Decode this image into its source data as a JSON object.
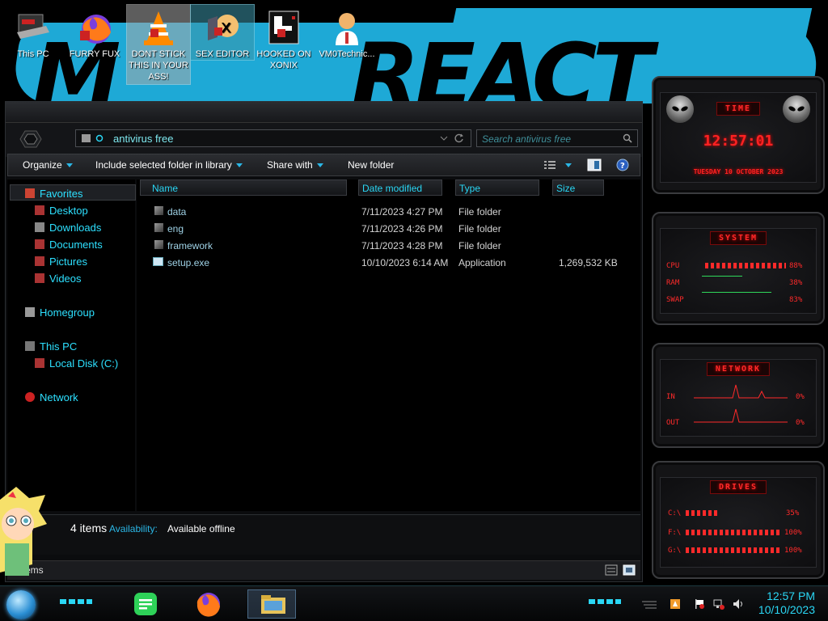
{
  "desktop": {
    "icons": [
      {
        "label": "This PC"
      },
      {
        "label": "FURRY FUX"
      },
      {
        "label": "DONT STICK THIS IN YOUR ASS!"
      },
      {
        "label": "SEX EDITOR"
      },
      {
        "label": "HOOKED ON XONIX"
      },
      {
        "label": "VM0Technic..."
      }
    ]
  },
  "explorer": {
    "address": "antivirus free",
    "search_placeholder": "Search antivirus free",
    "toolbar": {
      "organize": "Organize",
      "include": "Include selected folder in library",
      "share": "Share with",
      "new_folder": "New folder"
    },
    "nav": {
      "favorites": "Favorites",
      "desktop": "Desktop",
      "downloads": "Downloads",
      "documents": "Documents",
      "pictures": "Pictures",
      "videos": "Videos",
      "homegroup": "Homegroup",
      "this_pc": "This PC",
      "local_disk": "Local Disk (C:)",
      "network": "Network"
    },
    "columns": {
      "name": "Name",
      "date": "Date modified",
      "type": "Type",
      "size": "Size"
    },
    "files": [
      {
        "name": "data",
        "date": "7/11/2023 4:27 PM",
        "type": "File folder",
        "size": ""
      },
      {
        "name": "eng",
        "date": "7/11/2023 4:26 PM",
        "type": "File folder",
        "size": ""
      },
      {
        "name": "framework",
        "date": "7/11/2023 4:28 PM",
        "type": "File folder",
        "size": ""
      },
      {
        "name": "setup.exe",
        "date": "10/10/2023 6:14 AM",
        "type": "Application",
        "size": "1,269,532 KB"
      }
    ],
    "details": {
      "count": "4 items",
      "availability_label": "Availability:",
      "availability_value": "Available offline"
    },
    "status": "ems"
  },
  "gadgets": {
    "time": {
      "title": "TIME",
      "clock": "12:57:01",
      "date": "TUESDAY 10 OCTOBER 2023"
    },
    "system": {
      "title": "SYSTEM",
      "rows": [
        {
          "label": "CPU",
          "value": "88%"
        },
        {
          "label": "RAM",
          "value": "38%"
        },
        {
          "label": "SWAP",
          "value": "83%"
        }
      ]
    },
    "network": {
      "title": "NETWORK",
      "rows": [
        {
          "label": "IN",
          "value": "0%"
        },
        {
          "label": "OUT",
          "value": "0%"
        }
      ]
    },
    "drives": {
      "title": "DRIVES",
      "rows": [
        {
          "label": "C:\\",
          "value": "35%"
        },
        {
          "label": "F:\\",
          "value": "100%"
        },
        {
          "label": "G:\\",
          "value": "100%"
        }
      ]
    }
  },
  "taskbar": {
    "time": "12:57 PM",
    "date": "10/10/2023"
  },
  "colors": {
    "accent_cyan": "#2ad7f5",
    "gadget_red": "#ff2a2a",
    "wallpaper_blue": "#1ea9d6"
  }
}
